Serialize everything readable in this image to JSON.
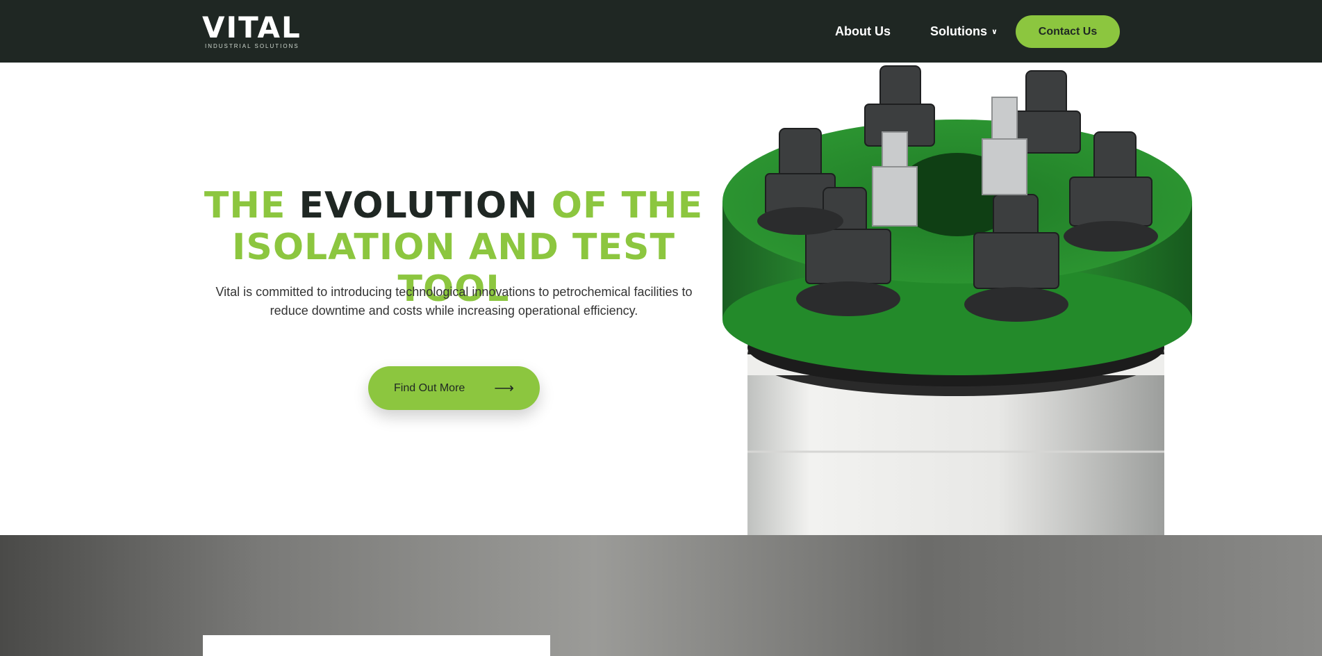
{
  "brand": {
    "name": "VITAL",
    "tagline": "INDUSTRIAL SOLUTIONS",
    "accent": "#8cc63f",
    "dark": "#1f2723"
  },
  "nav": {
    "about": "About Us",
    "solutions": "Solutions",
    "contact": "Contact Us"
  },
  "hero": {
    "title_w1": "THE",
    "title_w2": "EVOLUTION",
    "title_w3": "OF THE",
    "title_line2": "ISOLATION AND TEST TOOL",
    "description": "Vital is committed to introducing technological innovations to petrochemical facilities to reduce downtime and costs while increasing operational efficiency.",
    "cta": "Find Out More",
    "cta_arrow": "⟶"
  },
  "icons": {
    "solutions_dropdown": "chevron-down-icon",
    "cta": "arrow-right-icon"
  }
}
